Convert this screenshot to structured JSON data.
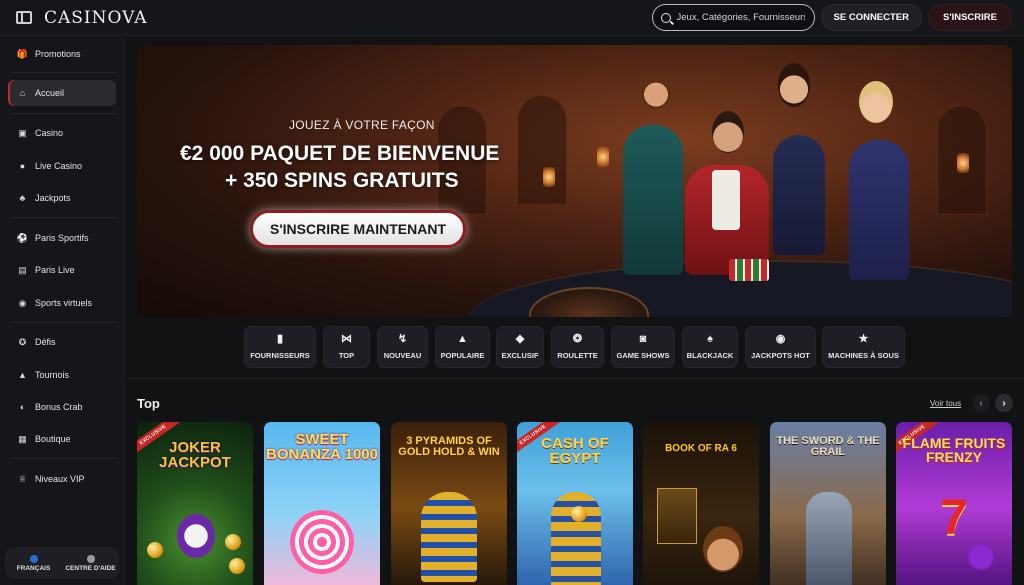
{
  "header": {
    "logo": "CASINOVA",
    "search_placeholder": "Jeux, Catégories, Fournisseurs",
    "login_label": "SE CONNECTER",
    "signup_label": "S'INSCRIRE"
  },
  "sidebar": {
    "items": [
      {
        "label": "Promotions",
        "icon": "gift-icon"
      },
      {
        "label": "Accueil",
        "icon": "home-icon",
        "active": true
      },
      {
        "label": "Casino",
        "icon": "slot-machine-icon"
      },
      {
        "label": "Live Casino",
        "icon": "live-dealer-icon"
      },
      {
        "label": "Jackpots",
        "icon": "clover-icon"
      },
      {
        "label": "Paris Sportifs",
        "icon": "soccer-ball-icon"
      },
      {
        "label": "Paris Live",
        "icon": "live-tv-icon"
      },
      {
        "label": "Sports virtuels",
        "icon": "virtual-sports-icon"
      },
      {
        "label": "Défis",
        "icon": "medal-icon"
      },
      {
        "label": "Tournois",
        "icon": "trophy-icon"
      },
      {
        "label": "Bonus Crab",
        "icon": "claw-machine-icon"
      },
      {
        "label": "Boutique",
        "icon": "shop-icon"
      },
      {
        "label": "Niveaux VIP",
        "icon": "crown-icon"
      }
    ],
    "footer": {
      "language_label": "FRANÇAIS",
      "help_label": "CENTRE D'AIDE"
    }
  },
  "banner": {
    "subtitle": "JOUEZ À VOTRE FAÇON",
    "headline_1": "€2 000 PAQUET DE BIENVENUE",
    "headline_2": "+ 350 SPINS GRATUITS",
    "cta_label": "S'INSCRIRE MAINTENANT"
  },
  "categories": [
    {
      "label": "FOURNISSEURS",
      "icon": "provider-card-icon"
    },
    {
      "label": "TOP",
      "icon": "bow-tie-icon"
    },
    {
      "label": "NOUVEAU",
      "icon": "lightning-icon"
    },
    {
      "label": "POPULAIRE",
      "icon": "flame-icon"
    },
    {
      "label": "EXCLUSIF",
      "icon": "diamond-icon"
    },
    {
      "label": "ROULETTE",
      "icon": "roulette-icon"
    },
    {
      "label": "GAME SHOWS",
      "icon": "mask-icon"
    },
    {
      "label": "BLACKJACK",
      "icon": "cards-icon"
    },
    {
      "label": "JACKPOTS HOT",
      "icon": "hot-coin-icon"
    },
    {
      "label": "MACHINES À SOUS",
      "icon": "777-icon"
    }
  ],
  "top_section": {
    "title": "Top",
    "see_all": "Voir tous"
  },
  "games": [
    {
      "title": "JOKER JACKPOT",
      "exclusive": true
    },
    {
      "title": "SWEET BONANZA 1000",
      "exclusive": false
    },
    {
      "title": "3 PYRAMIDS OF GOLD HOLD & WIN",
      "exclusive": false
    },
    {
      "title": "CASH OF EGYPT",
      "exclusive": true
    },
    {
      "title": "BOOK OF RA 6",
      "exclusive": false
    },
    {
      "title": "THE SWORD & THE GRAIL",
      "exclusive": false
    },
    {
      "title": "FLAME FRUITS FRENZY",
      "exclusive": true
    }
  ],
  "badge_label": "EXCLUSIVE",
  "colors": {
    "background": "#111214",
    "accent_red": "#c0272d",
    "sidebar": "#151619"
  }
}
